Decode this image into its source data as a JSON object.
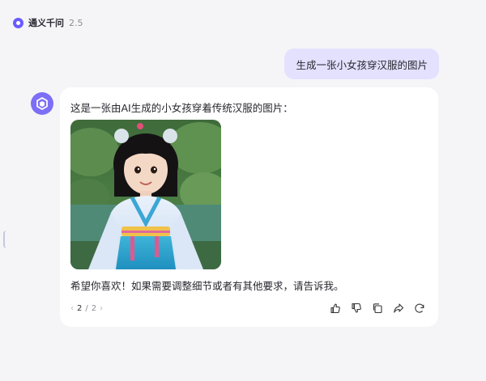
{
  "header": {
    "app_name": "通义千问",
    "version": "2.5"
  },
  "user_message": {
    "text": "生成一张小女孩穿汉服的图片"
  },
  "assistant_message": {
    "intro": "这是一张由AI生成的小女孩穿着传统汉服的图片：",
    "outro": "希望你喜欢！如果需要调整细节或者有其他要求，请告诉我。",
    "pager": {
      "current": "2",
      "separator": "/",
      "total": "2"
    },
    "actions": [
      {
        "icon": "thumbs-up-icon"
      },
      {
        "icon": "thumbs-down-icon"
      },
      {
        "icon": "copy-icon"
      },
      {
        "icon": "share-icon"
      },
      {
        "icon": "regenerate-icon"
      }
    ]
  },
  "colors": {
    "accent": "#6a5cff",
    "user_bubble": "#e4e1ff",
    "background": "#f5f5f8",
    "card": "#ffffff"
  }
}
